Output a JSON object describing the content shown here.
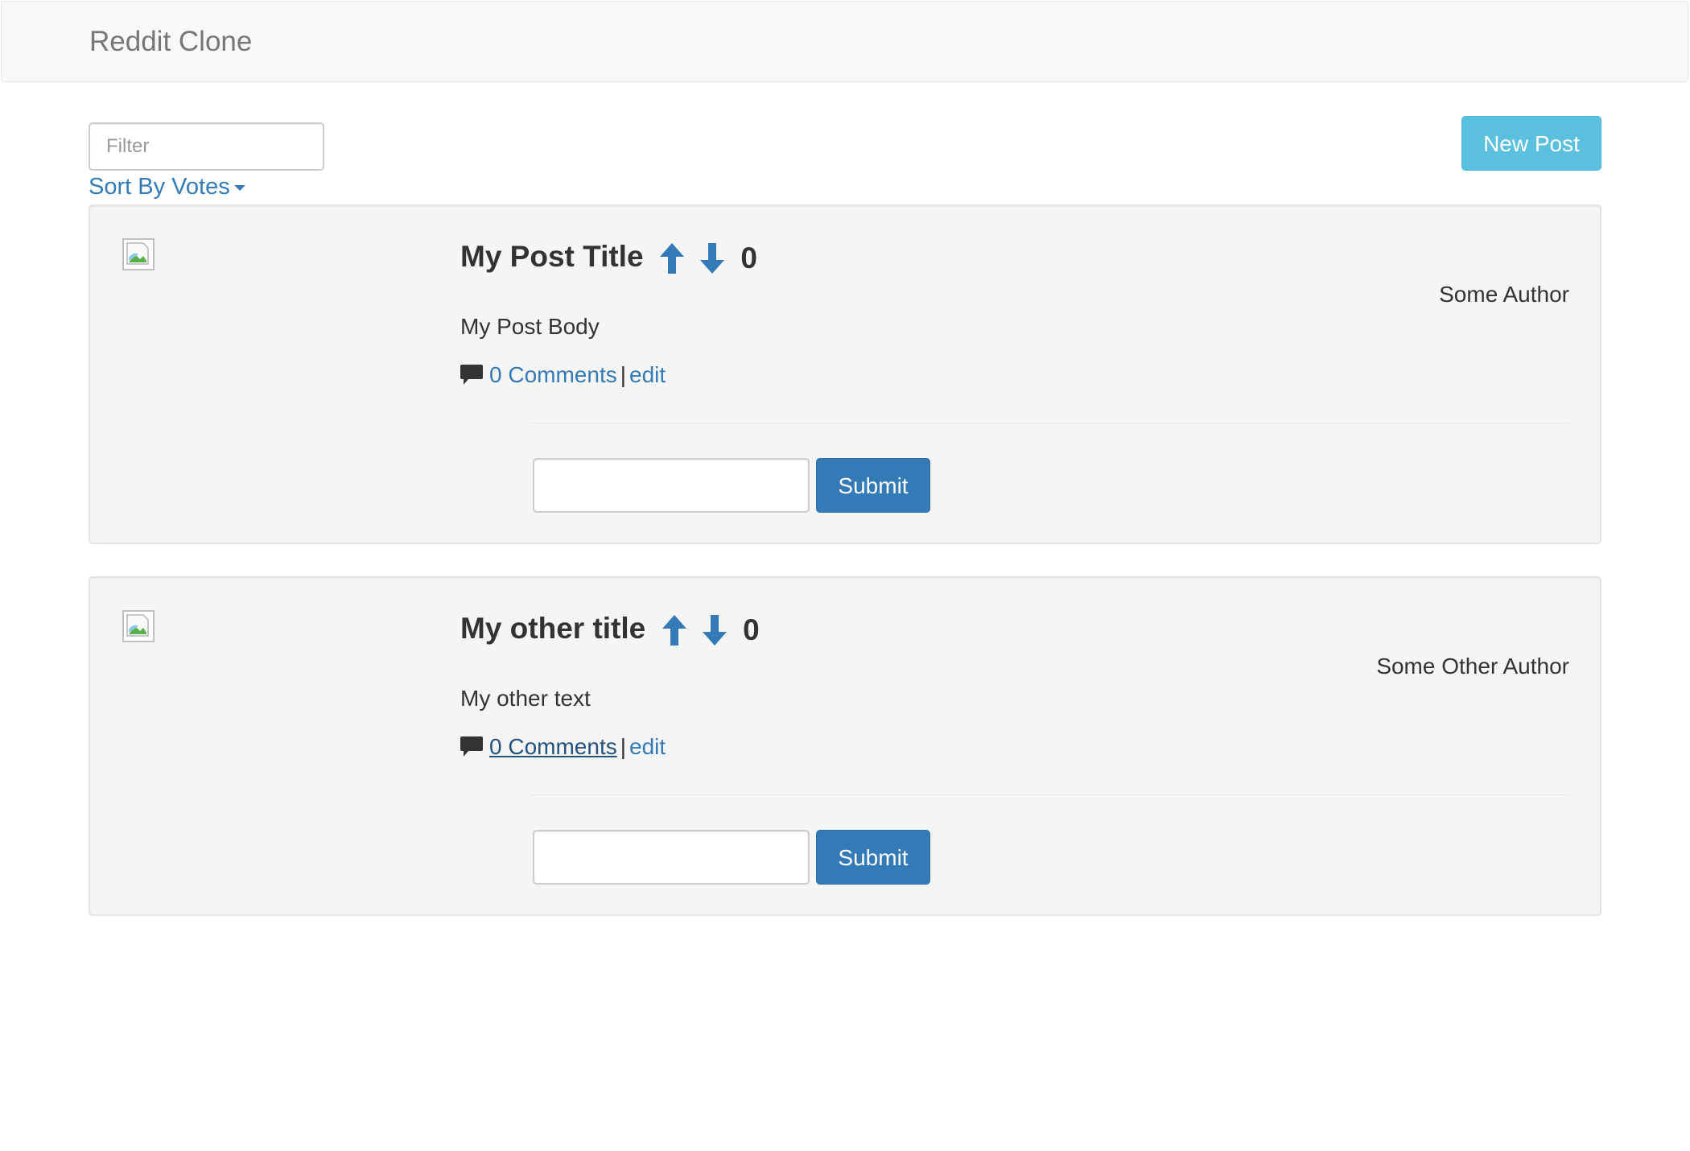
{
  "navbar": {
    "brand": "Reddit Clone"
  },
  "toolbar": {
    "filter_placeholder": "Filter",
    "sort_label": "Sort By Votes",
    "new_post_label": "New Post"
  },
  "colors": {
    "link": "#337ab7",
    "primary_button": "#337ab7",
    "info_button": "#5bc0de",
    "well_background": "#f5f5f5",
    "navbar_background": "#f8f8f8"
  },
  "icons": {
    "thumbnail": "broken-image-icon",
    "upvote": "arrow-up-icon",
    "downvote": "arrow-down-icon",
    "comment": "comment-bubble-icon",
    "sort_caret": "caret-down-icon"
  },
  "posts": [
    {
      "title": "My Post Title",
      "votes": "0",
      "author": "Some Author",
      "body": "My Post Body",
      "comments_label": "0 Comments",
      "separator": "|",
      "edit_label": "edit",
      "comment_value": "",
      "submit_label": "Submit"
    },
    {
      "title": "My other title",
      "votes": "0",
      "author": "Some Other Author",
      "body": "My other text",
      "comments_label": "0 Comments",
      "separator": "|",
      "edit_label": "edit",
      "comment_value": "",
      "submit_label": "Submit"
    }
  ]
}
